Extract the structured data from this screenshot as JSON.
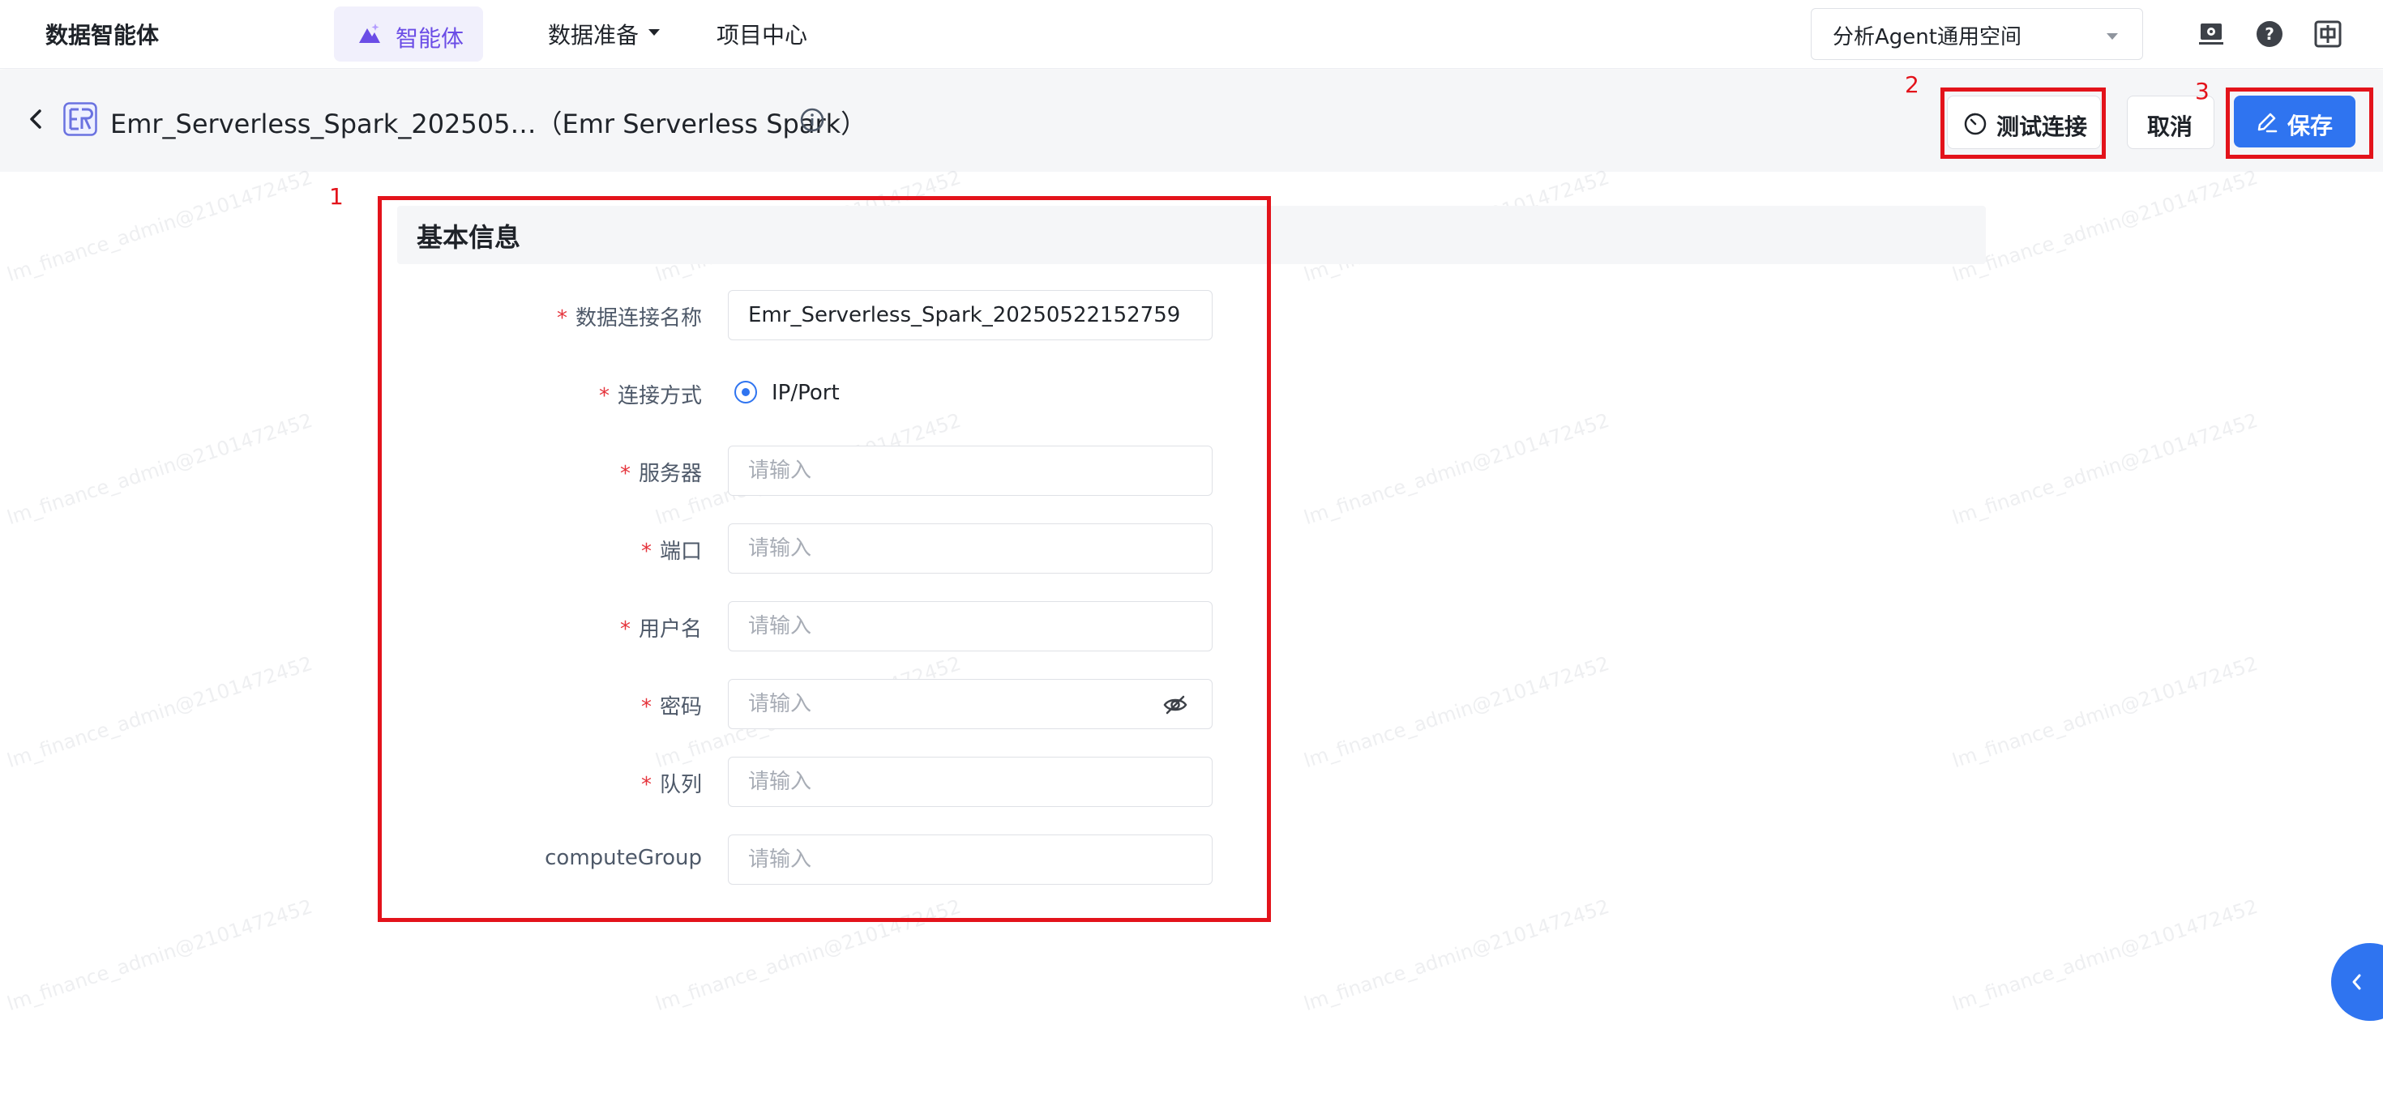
{
  "nav": {
    "brand": "数据智能体",
    "agent_tab": "智能体",
    "data_prep": "数据准备",
    "project_center": "项目中心",
    "workspace": "分析Agent通用空间"
  },
  "header": {
    "title": "Emr_Serverless_Spark_202505…（Emr Serverless Spark）",
    "test_button": "测试连接",
    "cancel_button": "取消",
    "save_button": "保存"
  },
  "section": {
    "title": "基本信息"
  },
  "form": {
    "required_mark": "*",
    "name_label": "数据连接名称",
    "name_value": "Emr_Serverless_Spark_20250522152759",
    "method_label": "连接方式",
    "method_option": "IP/Port",
    "server_label": "服务器",
    "port_label": "端口",
    "user_label": "用户名",
    "password_label": "密码",
    "queue_label": "队列",
    "compute_label": "computeGroup",
    "placeholder": "请输入"
  },
  "annotations": [
    "1",
    "2",
    "3"
  ],
  "watermark": "lm_finance_admin@2101472452",
  "colors": {
    "primary": "#2f74f0",
    "agent_accent": "#6b4de6",
    "annotation": "#e3131b",
    "required": "#e5343c"
  }
}
